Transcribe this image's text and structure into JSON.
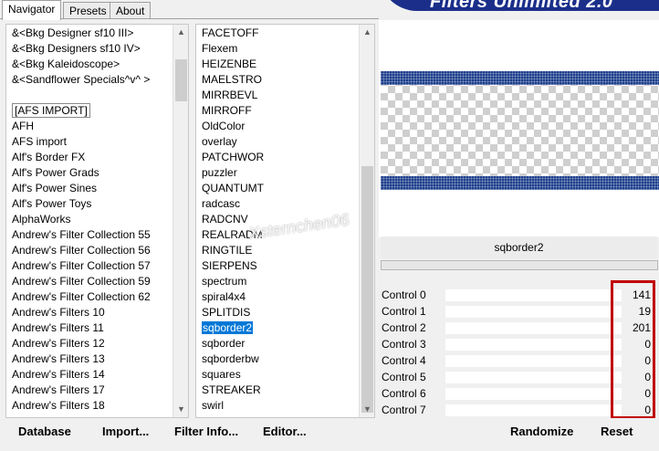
{
  "tabs": [
    "Navigator",
    "Presets",
    "About"
  ],
  "banner_title": "Filters Unlimited 2.0",
  "categories": [
    "&<Bkg Designer sf10 III>",
    "&<Bkg Designers sf10 IV>",
    "&<Bkg Kaleidoscope>",
    "&<Sandflower Specials^v^ >",
    "",
    "[AFS IMPORT]",
    "AFH",
    "AFS import",
    "Alf's Border FX",
    "Alf's Power Grads",
    "Alf's Power Sines",
    "Alf's Power Toys",
    "AlphaWorks",
    "Andrew's Filter Collection 55",
    "Andrew's Filter Collection 56",
    "Andrew's Filter Collection 57",
    "Andrew's Filter Collection 59",
    "Andrew's Filter Collection 62",
    "Andrew's Filters 10",
    "Andrew's Filters 11",
    "Andrew's Filters 12",
    "Andrew's Filters 13",
    "Andrew's Filters 14",
    "Andrew's Filters 17",
    "Andrew's Filters 18"
  ],
  "filters": [
    "FACETOFF",
    "Flexem",
    "HEIZENBE",
    "MAELSTRO",
    "MIRRBEVL",
    "MIRROFF",
    "OldColor",
    "overlay",
    "PATCHWOR",
    "puzzler",
    "QUANTUMT",
    "radcasc",
    "RADCNV",
    "REALRADM",
    "RINGTILE",
    "SIERPENS",
    "spectrum",
    "spiral4x4",
    "SPLITDIS",
    "sqborder2",
    "sqborder",
    "sqborderbw",
    "squares",
    "STREAKER",
    "swirl"
  ],
  "selected_filter": "sqborder2",
  "filter_name": "sqborder2",
  "watermark": "Xsternchen06",
  "controls": [
    {
      "label": "Control 0",
      "value": "141"
    },
    {
      "label": "Control 1",
      "value": "19"
    },
    {
      "label": "Control 2",
      "value": "201"
    },
    {
      "label": "Control 3",
      "value": "0"
    },
    {
      "label": "Control 4",
      "value": "0"
    },
    {
      "label": "Control 5",
      "value": "0"
    },
    {
      "label": "Control 6",
      "value": "0"
    },
    {
      "label": "Control 7",
      "value": "0"
    }
  ],
  "buttons": {
    "database": "Database",
    "import": "Import...",
    "filter_info": "Filter Info...",
    "editor": "Editor...",
    "randomize": "Randomize",
    "reset": "Reset"
  },
  "colors": {
    "selection": "#0078d7",
    "banner": "#1b2f8a",
    "highlight": "#c00000",
    "preview_band": "#1e3f8c"
  },
  "icons": [
    "up-arrow-icon",
    "down-arrow-icon"
  ]
}
